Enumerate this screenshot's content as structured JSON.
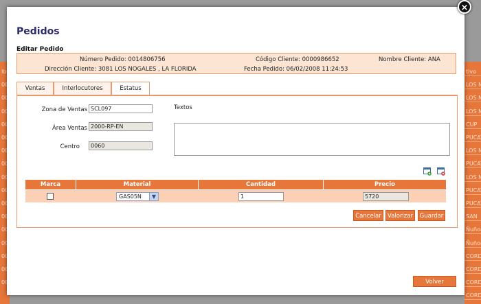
{
  "background": {
    "right_column_texts": [
      "tivo",
      "LOS N",
      "LOS N",
      "LOS N",
      "CUP",
      "PUCAT",
      "LOS N",
      "PUCAT",
      "LOS N",
      "PUCAT",
      "PUCAT",
      "SAN",
      "Ñuñoa",
      "Ñuñoa",
      "CORD",
      "CORD",
      "CORD",
      "CORD"
    ],
    "left_column_texts": [
      "Ib",
      "00",
      "00",
      "00",
      "00",
      "00",
      "00",
      "00",
      "00",
      "00",
      "00",
      "00",
      "00",
      "00",
      "00",
      "00",
      "00"
    ],
    "top_label": "Camión"
  },
  "modal": {
    "title": "Pedidos",
    "subtitle": "Editar Pedido",
    "info": {
      "numero_pedido": "Número Pedido: 0014806756",
      "codigo_cliente": "Código Cliente: 0000986652",
      "nombre_cliente": "Nombre Cliente: ANA",
      "direccion_cliente": "Dirección Cliente: 3081 LOS NOGALES , LA FLORIDA",
      "fecha_pedido": "Fecha Pedido: 06/02/2008 11:24:53"
    },
    "tabs": [
      "Ventas",
      "Interlocutores",
      "Estatus"
    ],
    "form": {
      "zona_label": "Zona de Ventas",
      "zona_value": "SCL097",
      "area_label": "Área Ventas",
      "area_value": "2000-RP-EN",
      "centro_label": "Centro",
      "centro_value": "0060",
      "textos_label": "Textos"
    },
    "icons": {
      "add": "add-row-icon",
      "delete": "delete-row-icon"
    },
    "grid": {
      "headers": [
        "Marca",
        "Material",
        "Cantidad",
        "Precio"
      ],
      "row": {
        "material": "GAS05N",
        "cantidad": "1",
        "precio": "5720"
      }
    },
    "buttons": {
      "cancelar": "Cancelar",
      "valorizar": "Valorizar",
      "guardar": "Guardar",
      "volver": "Volver"
    },
    "close": "×"
  },
  "colors": {
    "accent": "#e6763a",
    "row": "#fbd0b4",
    "title": "#2c2c6a"
  }
}
